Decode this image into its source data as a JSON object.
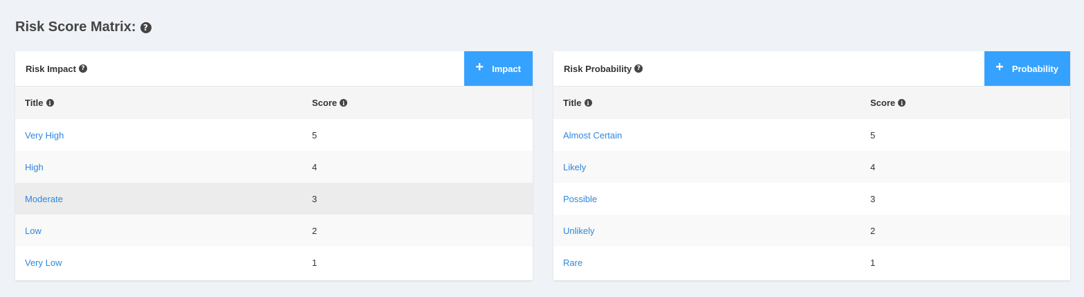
{
  "page": {
    "title": "Risk Score Matrix:"
  },
  "impact_panel": {
    "title": "Risk Impact",
    "add_button": "Impact",
    "columns": [
      "Title",
      "Score"
    ],
    "rows": [
      {
        "title": "Very High",
        "score": "5"
      },
      {
        "title": "High",
        "score": "4"
      },
      {
        "title": "Moderate",
        "score": "3"
      },
      {
        "title": "Low",
        "score": "2"
      },
      {
        "title": "Very Low",
        "score": "1"
      }
    ]
  },
  "probability_panel": {
    "title": "Risk Probability",
    "add_button": "Probability",
    "columns": [
      "Title",
      "Score"
    ],
    "rows": [
      {
        "title": "Almost Certain",
        "score": "5"
      },
      {
        "title": "Likely",
        "score": "4"
      },
      {
        "title": "Possible",
        "score": "3"
      },
      {
        "title": "Unlikely",
        "score": "2"
      },
      {
        "title": "Rare",
        "score": "1"
      }
    ]
  },
  "colors": {
    "accent": "#36a2ff",
    "link": "#2e86de",
    "background": "#eff2f7"
  },
  "icons": {
    "help": "question-circle-icon",
    "info": "info-circle-icon",
    "add": "plus-icon"
  }
}
